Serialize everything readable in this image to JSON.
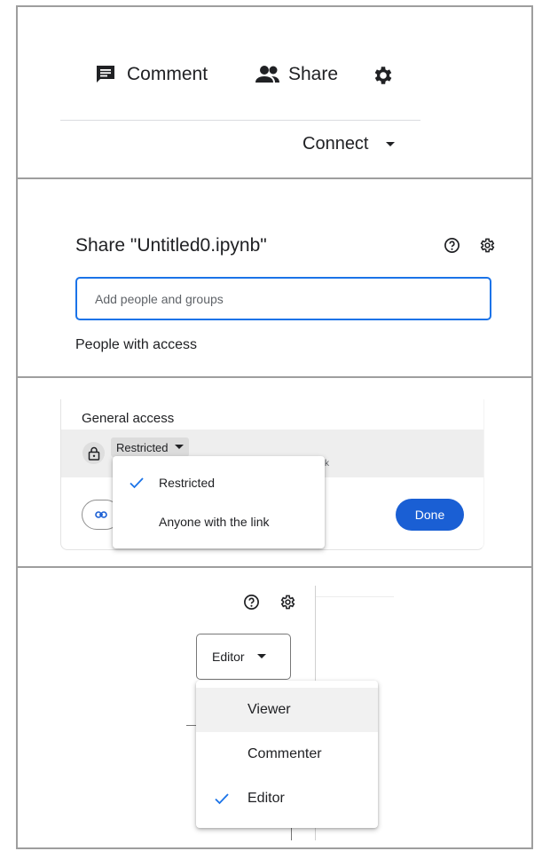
{
  "toolbar": {
    "comment_label": "Comment",
    "share_label": "Share",
    "connect_label": "Connect"
  },
  "share_dialog": {
    "title": "Share \"Untitled0.ipynb\"",
    "input_placeholder": "Add people and groups",
    "people_with_access": "People with access"
  },
  "general_access": {
    "heading": "General access",
    "selected": "Restricted",
    "truncated_text": "k",
    "options": [
      {
        "label": "Restricted",
        "checked": true
      },
      {
        "label": "Anyone with the link",
        "checked": false
      }
    ],
    "done_label": "Done"
  },
  "role_select": {
    "selected": "Editor",
    "options": [
      {
        "label": "Viewer",
        "checked": false,
        "hovered": true
      },
      {
        "label": "Commenter",
        "checked": false,
        "hovered": false
      },
      {
        "label": "Editor",
        "checked": true,
        "hovered": false
      }
    ]
  },
  "colors": {
    "accent": "#1a73e8",
    "done_button": "#1a5fd4",
    "text": "#202124"
  },
  "icons": [
    "comment-icon",
    "people-icon",
    "gear-icon",
    "chevron-down-icon",
    "help-icon",
    "settings-icon",
    "lock-icon",
    "link-icon",
    "check-icon"
  ]
}
